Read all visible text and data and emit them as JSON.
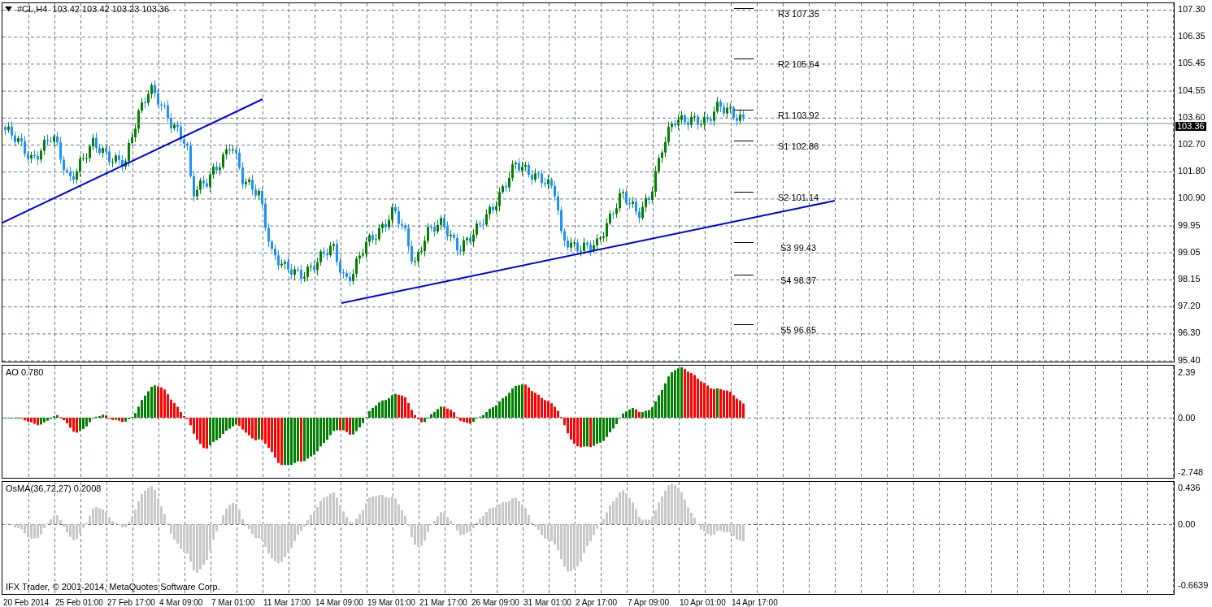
{
  "chart": {
    "symbol": "#CL,H4",
    "ohlc": "103.42 103.42 103.23 103.36"
  },
  "price_axis": {
    "ticks": [
      "107.30",
      "106.35",
      "105.45",
      "104.55",
      "103.60",
      "102.70",
      "101.80",
      "100.90",
      "99.95",
      "99.05",
      "98.15",
      "97.20",
      "96.30",
      "95.40"
    ],
    "current_price": "103.36"
  },
  "pivots": [
    {
      "label": "R3 107.35"
    },
    {
      "label": "R2 105.64"
    },
    {
      "label": "R1 103.92"
    },
    {
      "label": "S1 102.86"
    },
    {
      "label": "S2 101.14"
    },
    {
      "label": "S3 99.43"
    },
    {
      "label": "S4 98.37"
    },
    {
      "label": "S5 96.65"
    }
  ],
  "indicators": [
    {
      "kind": "ao",
      "label": "AO 0.780",
      "ticks": [
        "2.39",
        "0.00",
        "-2.748"
      ]
    },
    {
      "kind": "osma",
      "label": "OsMA(36,72,27) 0.2008",
      "ticks": [
        "0.436",
        "0.00",
        "-0.6639"
      ]
    }
  ],
  "copyright": "IFX Trader, © 2001-2014, MetaQuotes Software Corp.",
  "time_axis": [
    "20 Feb 2014",
    "25 Feb 01:00",
    "27 Feb 17:00",
    "4 Mar 09:00",
    "7 Mar 01:00",
    "11 Mar 17:00",
    "14 Mar 09:00",
    "19 Mar 01:00",
    "21 Mar 17:00",
    "26 Mar 09:00",
    "31 Mar 01:00",
    "2 Apr 17:00",
    "7 Apr 09:00",
    "10 Apr 01:00",
    "14 Apr 17:00"
  ]
}
